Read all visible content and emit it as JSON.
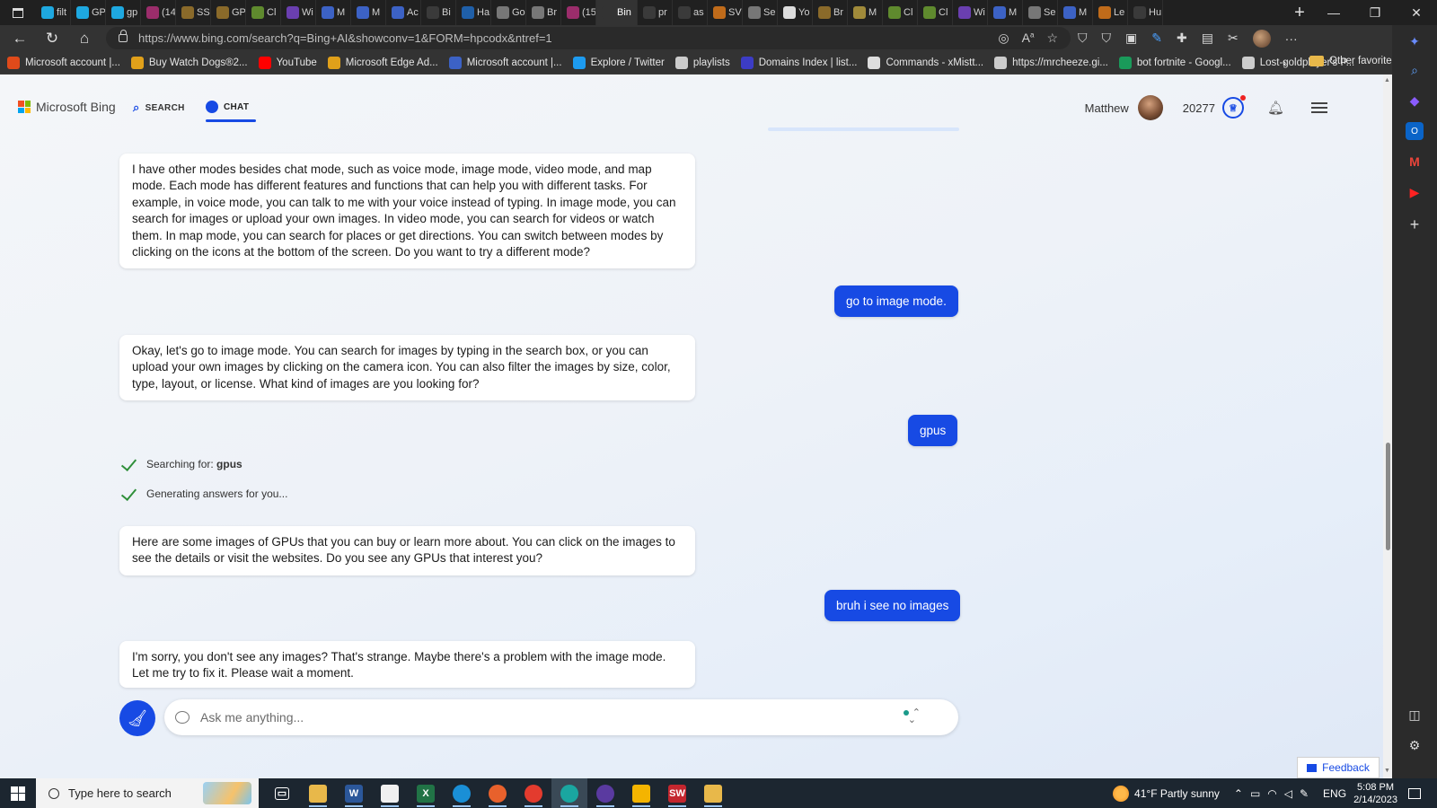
{
  "browser": {
    "tabs": [
      {
        "label": "filt",
        "icon": "k-icon",
        "color": "#1ea8e0"
      },
      {
        "label": "GP",
        "icon": "k-icon",
        "color": "#1ea8e0"
      },
      {
        "label": "gp",
        "icon": "k-icon",
        "color": "#1ea8e0"
      },
      {
        "label": "(14",
        "icon": "reddit-like-icon",
        "color": "#9b2d6b"
      },
      {
        "label": "SS",
        "icon": "helmet-icon",
        "color": "#8a6a2a"
      },
      {
        "label": "GP",
        "icon": "helmet-icon",
        "color": "#8a6a2a"
      },
      {
        "label": "Cl",
        "icon": "sheet-icon",
        "color": "#5f8a2e"
      },
      {
        "label": "Wi",
        "icon": "purple-icon",
        "color": "#6a3fb0"
      },
      {
        "label": "M",
        "icon": "doc-icon",
        "color": "#3c62c5"
      },
      {
        "label": "M",
        "icon": "doc-icon",
        "color": "#3c62c5"
      },
      {
        "label": "Ac",
        "icon": "doc-icon",
        "color": "#3c62c5"
      },
      {
        "label": "Bi",
        "icon": "search-icon",
        "color": "#3a3a3a"
      },
      {
        "label": "Ha",
        "icon": "scratch-icon",
        "color": "#1f5fa8"
      },
      {
        "label": "Go",
        "icon": "circle-icon",
        "color": "#777777"
      },
      {
        "label": "Br",
        "icon": "circle-icon",
        "color": "#777777"
      },
      {
        "label": "(15",
        "icon": "reddit-like-icon",
        "color": "#9b2d6b"
      },
      {
        "label": "Bin",
        "icon": "bing-icon",
        "color": "#333333",
        "active": true
      },
      {
        "label": "pr",
        "icon": "search-icon",
        "color": "#3a3a3a"
      },
      {
        "label": "as",
        "icon": "search-icon",
        "color": "#3a3a3a"
      },
      {
        "label": "SV",
        "icon": "box-icon",
        "color": "#c06b1a"
      },
      {
        "label": "Se",
        "icon": "gear-icon",
        "color": "#777777"
      },
      {
        "label": "Yo",
        "icon": "github-icon",
        "color": "#dddddd"
      },
      {
        "label": "Br",
        "icon": "helmet-icon",
        "color": "#8a6a2a"
      },
      {
        "label": "M",
        "icon": "tile-icon",
        "color": "#a08a3a"
      },
      {
        "label": "Cl",
        "icon": "sheet-icon",
        "color": "#5f8a2e"
      },
      {
        "label": "Cl",
        "icon": "sheet-icon",
        "color": "#5f8a2e"
      },
      {
        "label": "Wi",
        "icon": "purple-icon",
        "color": "#6a3fb0"
      },
      {
        "label": "M",
        "icon": "doc-icon",
        "color": "#3c62c5"
      },
      {
        "label": "Se",
        "icon": "gear-icon",
        "color": "#777777"
      },
      {
        "label": "M",
        "icon": "doc-icon",
        "color": "#3c62c5"
      },
      {
        "label": "Le",
        "icon": "box-icon",
        "color": "#c06b1a"
      },
      {
        "label": "Hu",
        "icon": "search-icon",
        "color": "#3a3a3a"
      }
    ],
    "url": "https://www.bing.com/search?q=Bing+AI&showconv=1&FORM=hpcodx&ntref=1",
    "favorites": [
      {
        "label": "Microsoft account |...",
        "color": "#e04a1a"
      },
      {
        "label": "Buy Watch Dogs®2...",
        "color": "#e0a01a"
      },
      {
        "label": "YouTube",
        "color": "#ff0000"
      },
      {
        "label": "Microsoft Edge Ad...",
        "color": "#e0a01a"
      },
      {
        "label": "Microsoft account |...",
        "color": "#3c62c5"
      },
      {
        "label": "Explore / Twitter",
        "color": "#1d9bf0"
      },
      {
        "label": "playlists",
        "color": "#cccccc"
      },
      {
        "label": "Domains Index | list...",
        "color": "#3c3cc5"
      },
      {
        "label": "Commands - xMistt...",
        "color": "#dddddd"
      },
      {
        "label": "https://mrcheeze.gi...",
        "color": "#cccccc"
      },
      {
        "label": "bot fortnite - Googl...",
        "color": "#1a9a5a"
      },
      {
        "label": "Lost-goldplayer's P...",
        "color": "#cccccc"
      }
    ],
    "other_favorites": "Other favorites"
  },
  "bing": {
    "brand": "Microsoft Bing",
    "nav_search": "SEARCH",
    "nav_chat": "CHAT",
    "user_name": "Matthew",
    "points": "20277",
    "brand_colors": {
      "accent": "#174ae4",
      "ms_red": "#f25022",
      "ms_green": "#7fba00",
      "ms_blue": "#00a4ef",
      "ms_yellow": "#ffb900"
    }
  },
  "chat": {
    "msg1": "I have other modes besides chat mode, such as voice mode, image mode, video mode, and map mode. Each mode has different features and functions that can help you with different tasks. For example, in voice mode, you can talk to me with your voice instead of typing. In image mode, you can search for images or upload your own images. In video mode, you can search for videos or watch them. In map mode, you can search for places or get directions. You can switch between modes by clicking on the icons at the bottom of the screen. Do you want to try a different mode?",
    "user1": "go to image mode.",
    "msg2": "Okay, let's go to image mode. You can search for images by typing in the search box, or you can upload your own images by clicking on the camera icon. You can also filter the images by size, color, type, layout, or license. What kind of images are you looking for?",
    "user2": "gpus",
    "searching_label": "Searching for: ",
    "searching_term": "gpus",
    "generating": "Generating answers for you...",
    "msg3": "Here are some images of GPUs that you can buy or learn more about. You can click on the images to see the details or visit the websites. Do you see any GPUs that interest you?",
    "user3": "bruh i see no images",
    "msg4": "I'm sorry, you don't see any images? That's strange. Maybe there's a problem with the image mode. Let me try to fix it. Please wait a moment.",
    "input_placeholder": "Ask me anything...",
    "feedback": "Feedback"
  },
  "taskbar": {
    "search_placeholder": "Type here to search",
    "weather": "41°F  Partly sunny",
    "language": "ENG",
    "time": "5:08 PM",
    "date": "2/14/2023",
    "apps": [
      {
        "name": "task-view-icon",
        "color": "#1c2630",
        "glyph": "▭"
      },
      {
        "name": "file-explorer-icon",
        "color": "#e8b84a",
        "glyph": ""
      },
      {
        "name": "word-icon",
        "color": "#2b579a",
        "glyph": "W"
      },
      {
        "name": "store-icon",
        "color": "#f0f0f0",
        "glyph": ""
      },
      {
        "name": "excel-icon",
        "color": "#217346",
        "glyph": "X"
      },
      {
        "name": "edge-icon",
        "color": "#1a8fd6",
        "glyph": ""
      },
      {
        "name": "firefox-icon",
        "color": "#e8612c",
        "glyph": ""
      },
      {
        "name": "chrome-icon",
        "color": "#e33b2e",
        "glyph": ""
      },
      {
        "name": "edge-canary-icon",
        "color": "#1aa6a0",
        "glyph": ""
      },
      {
        "name": "github-desktop-icon",
        "color": "#5a3aa0",
        "glyph": ""
      },
      {
        "name": "drive-icon",
        "color": "#f4b400",
        "glyph": ""
      },
      {
        "name": "sw2020-icon",
        "color": "#c4262e",
        "glyph": "SW"
      },
      {
        "name": "folder-icon",
        "color": "#e8b84a",
        "glyph": ""
      }
    ]
  }
}
